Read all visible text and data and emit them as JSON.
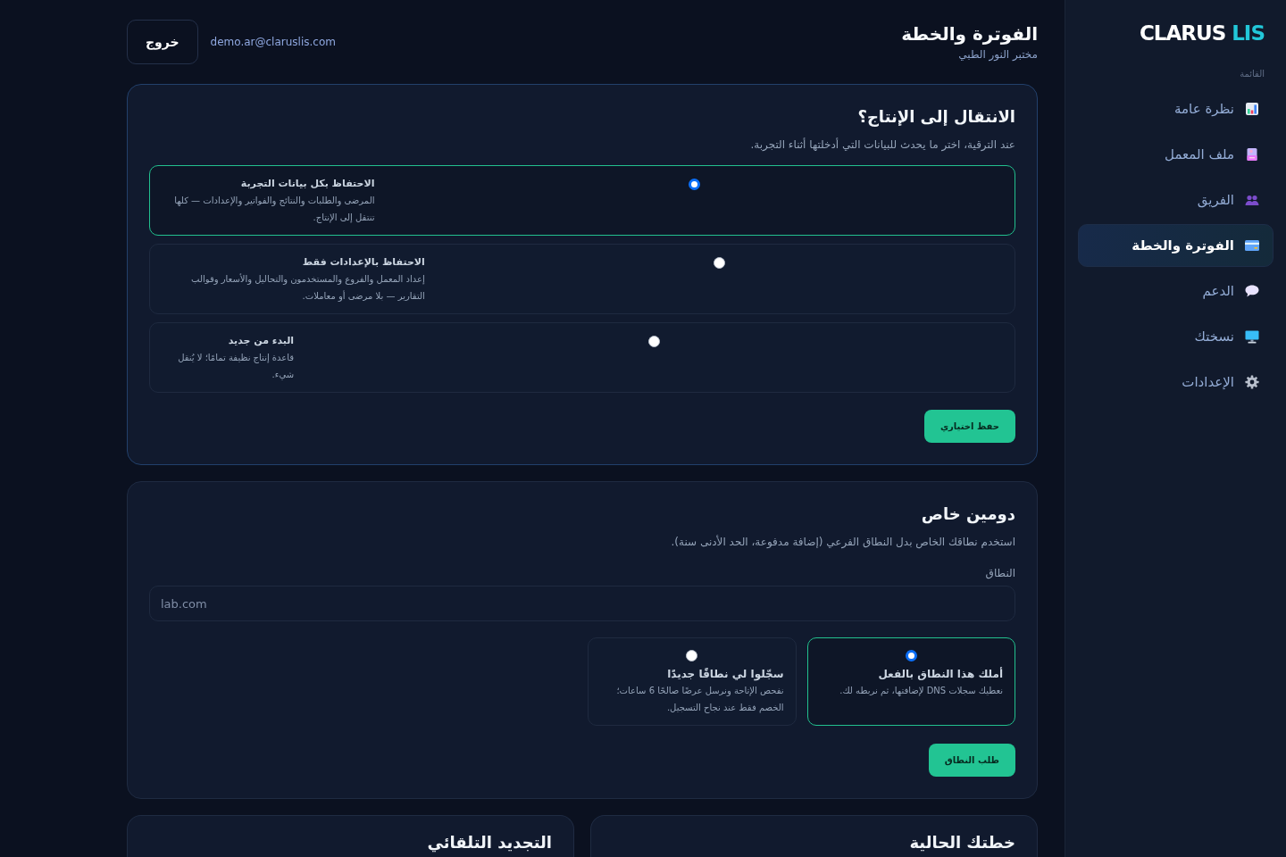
{
  "sidebar": {
    "logo": {
      "text": "CLARUS",
      "accent": "LIS"
    },
    "section_label": "القائمة",
    "items": [
      {
        "label": "نظرة عامة",
        "selected": false
      },
      {
        "label": "ملف المعمل",
        "selected": false
      },
      {
        "label": "الفريق",
        "selected": false
      },
      {
        "label": "الفوترة والخطة",
        "selected": true
      },
      {
        "label": "الدعم",
        "selected": false
      },
      {
        "label": "نسختك",
        "selected": false
      },
      {
        "label": "الإعدادات",
        "selected": false
      }
    ]
  },
  "header": {
    "title": "الفوترة والخطة",
    "subtitle": "مختبر النور الطبي",
    "user_email": "demo.ar@claruslis.com",
    "logout_button": "خروج"
  },
  "production_migration": {
    "title": "الانتقال إلى الإنتاج؟",
    "description": "عند الترقية، اختر ما يحدث للبيانات التي أدخلتها أثناء التجربة.",
    "options": [
      {
        "title": "الاحتفاظ بكل بيانات التجربة",
        "description": "المرضى والطلبات والنتائج والفواتير والإعدادات — كلها تنتقل إلى الإنتاج.",
        "selected": true
      },
      {
        "title": "الاحتفاظ بالإعدادات فقط",
        "description": "إعداد المعمل والفروع والمستخدمون والتحاليل والأسعار وقوالب التقارير — بلا مرضى أو معاملات.",
        "selected": false
      },
      {
        "title": "البدء من جديد",
        "description": "قاعدة إنتاج نظيفة تمامًا؛ لا يُنقل شيء.",
        "selected": false
      }
    ],
    "save_button": "حفظ اختياري"
  },
  "custom_domain": {
    "title": "دومين خاص",
    "description": "استخدم نطاقك الخاص بدل النطاق الفرعي (إضافة مدفوعة، الحد الأدنى سنة).",
    "domain_field": {
      "label": "النطاق",
      "placeholder": "lab.com"
    },
    "options": [
      {
        "title": "أملك هذا النطاق بالفعل",
        "description": "نعطيك سجلات DNS لإضافتها، ثم نربطه لك.",
        "selected": true
      },
      {
        "title": "سجّلوا لي نطاقًا جديدًا",
        "description": "نفحص الإتاحة ونرسل عرضًا صالحًا 6 ساعات؛ الخصم فقط عند نجاح التسجيل.",
        "selected": false
      }
    ],
    "request_button": "طلب النطاق"
  },
  "bottom_cards": [
    {
      "title": "خطتك الحالية"
    },
    {
      "title": "التجديد التلقائي"
    }
  ]
}
